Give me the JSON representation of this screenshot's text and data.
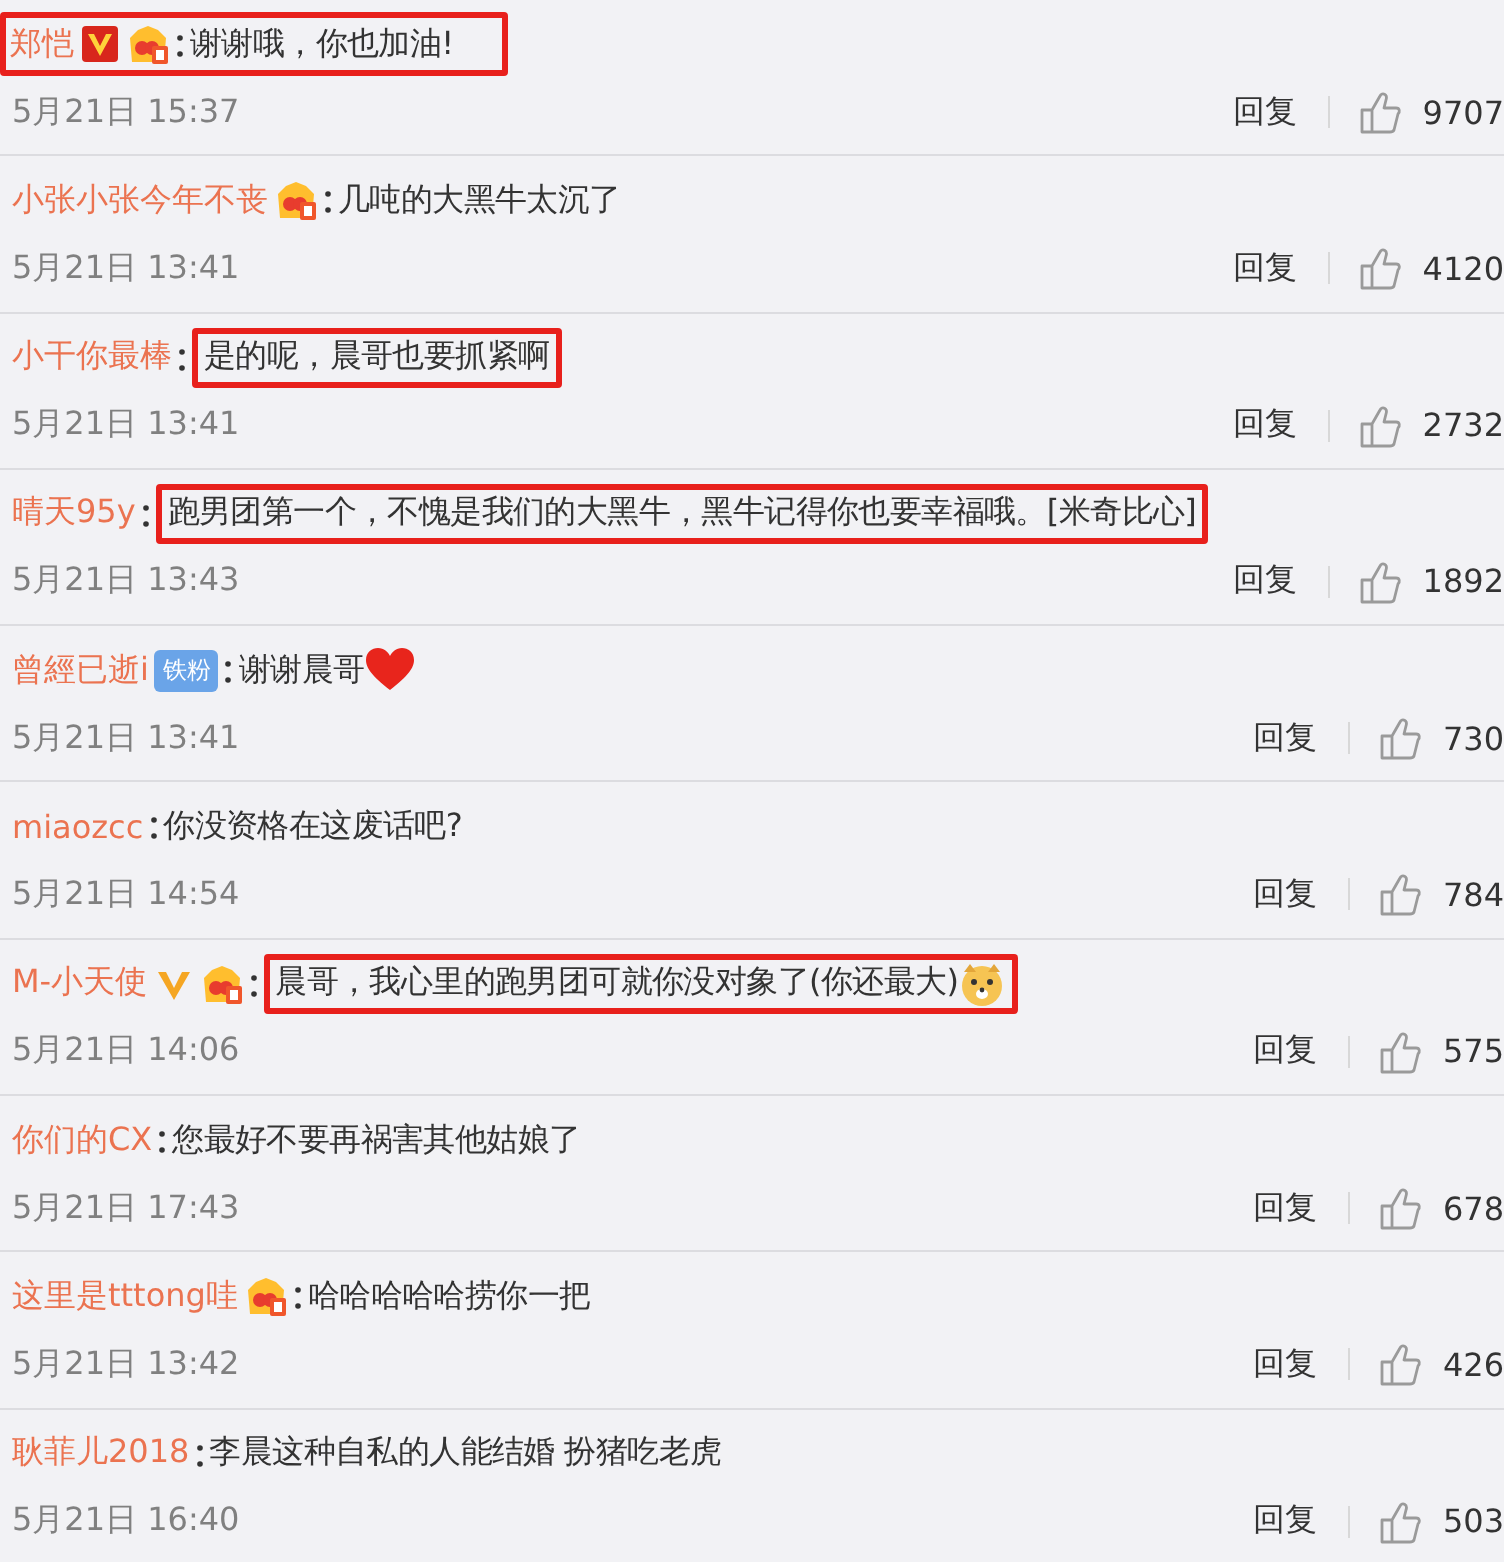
{
  "comments": [
    {
      "kind": "framed-line",
      "user": "郑恺",
      "badges": [
        {
          "kind": "red-v"
        },
        {
          "kind": "crown"
        }
      ],
      "text": "谢谢哦，你也加油!",
      "date": "5月21日 15:37",
      "reply": "回复",
      "likes": "9707"
    },
    {
      "kind": "plain",
      "user": "小张小张今年不丧",
      "badges": [
        {
          "kind": "crown"
        }
      ],
      "text": "几吨的大黑牛太沉了",
      "date": "5月21日 13:41",
      "reply": "回复",
      "likes": "4120"
    },
    {
      "kind": "framed-text",
      "user": "小干你最棒",
      "text": "是的呢，晨哥也要抓紧啊",
      "date": "5月21日 13:41",
      "reply": "回复",
      "likes": "2732"
    },
    {
      "kind": "framed-text",
      "user": "晴天95y",
      "text": "跑男团第一个，不愧是我们的大黑牛，黑牛记得你也要幸福哦。[米奇比心]",
      "date": "5月21日 13:43",
      "reply": "回复",
      "likes": "1892"
    },
    {
      "kind": "plain",
      "user": "曾經已逝i",
      "badges": [
        {
          "kind": "fan",
          "label": "铁粉"
        }
      ],
      "text": "谢谢晨哥",
      "emojis": [
        {
          "kind": "heart"
        }
      ],
      "date": "5月21日 13:41",
      "reply": "回复",
      "likes": "730"
    },
    {
      "kind": "plain",
      "user": "miaozcc",
      "text": "你没资格在这废话吧?",
      "date": "5月21日 14:54",
      "reply": "回复",
      "likes": "784"
    },
    {
      "kind": "framed-text",
      "user": "M-小天使",
      "badges": [
        {
          "kind": "gold-v"
        },
        {
          "kind": "crown"
        }
      ],
      "text": "晨哥，我心里的跑男团可就你没对象了(你还最大)",
      "emojis": [
        {
          "kind": "dog"
        }
      ],
      "date": "5月21日 14:06",
      "reply": "回复",
      "likes": "575"
    },
    {
      "kind": "plain",
      "user": "你们的CX",
      "text": "您最好不要再祸害其他姑娘了",
      "date": "5月21日 17:43",
      "reply": "回复",
      "likes": "678"
    },
    {
      "kind": "plain",
      "user": "这里是tttong哇",
      "badges": [
        {
          "kind": "crown"
        }
      ],
      "text": "哈哈哈哈哈捞你一把",
      "date": "5月21日 13:42",
      "reply": "回复",
      "likes": "426"
    },
    {
      "kind": "plain",
      "user": "耿菲儿2018",
      "text": "李晨这种自私的人能结婚 扮猪吃老虎",
      "date": "5月21日 16:40",
      "reply": "回复",
      "likes": "503"
    }
  ]
}
